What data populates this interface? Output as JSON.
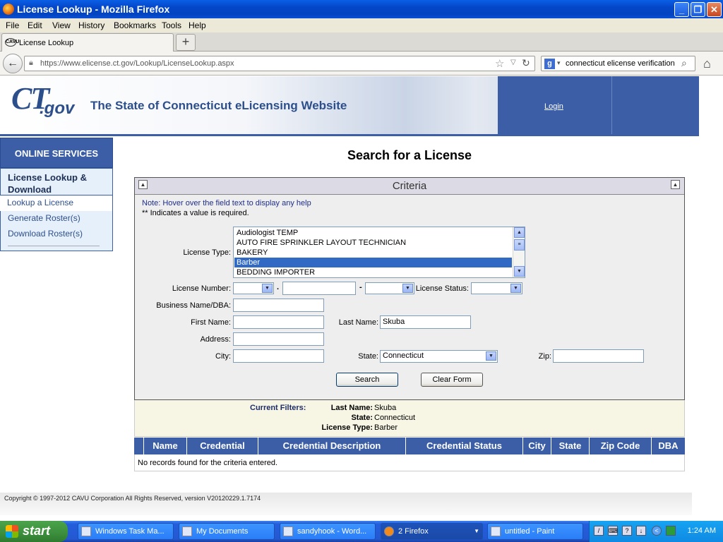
{
  "window": {
    "title": "License Lookup - Mozilla Firefox",
    "minimize": "_",
    "maximize": "❐",
    "close": "✕"
  },
  "menu": [
    "File",
    "Edit",
    "View",
    "History",
    "Bookmarks",
    "Tools",
    "Help"
  ],
  "tab": {
    "label": "License Lookup",
    "icon_text": "CAVU",
    "new_tab": "+"
  },
  "nav": {
    "url": "https://www.elicense.ct.gov/Lookup/LicenseLookup.aspx",
    "search_value": "connecticut elicense verification",
    "search_engine_icon": "g"
  },
  "banner": {
    "logo_ct": "CT",
    "logo_gov": ".gov",
    "title": "The State of Connecticut eLicensing Website",
    "login": "Login"
  },
  "sidebar": {
    "header": "ONLINE SERVICES",
    "section": "License Lookup & Download",
    "items": [
      "Lookup a License",
      "Generate Roster(s)",
      "Download Roster(s)"
    ]
  },
  "main": {
    "heading": "Search for a License",
    "criteria_title": "Criteria",
    "note": "Note:  Hover over the field text to display any help",
    "required": "** Indicates a value is required."
  },
  "form": {
    "license_type_label": "License Type:",
    "license_types": [
      "Audiologist TEMP",
      "AUTO FIRE SPRINKLER LAYOUT TECHNICIAN",
      "BAKERY",
      "Barber",
      "BEDDING IMPORTER"
    ],
    "selected_index": 3,
    "license_number_label": "License Number:",
    "dot": ".",
    "dash": "-",
    "license_status_label": "License Status:",
    "business_name_label": "Business Name/DBA:",
    "business_name": "",
    "first_name_label": "First Name:",
    "first_name": "",
    "last_name_label": "Last Name:",
    "last_name": "Skuba",
    "address_label": "Address:",
    "address": "",
    "city_label": "City:",
    "city": "",
    "state_label": "State:",
    "state": "Connecticut",
    "zip_label": "Zip:",
    "zip": "",
    "search_button": "Search",
    "clear_button": "Clear Form"
  },
  "filters": {
    "header": "Current Filters:",
    "last_name_label": "Last Name:",
    "last_name": "Skuba",
    "state_label": "State:",
    "state": "Connecticut",
    "license_type_label": "License Type:",
    "license_type": "Barber"
  },
  "results": {
    "columns": [
      "Name",
      "Credential",
      "Credential Description",
      "Credential Status",
      "City",
      "State",
      "Zip Code",
      "DBA"
    ],
    "empty_message": "No records found for the criteria entered."
  },
  "footer": {
    "copyright": "Copyright © 1997-2012 CAVU Corporation All Rights Reserved, version V20120229.1.7174"
  },
  "taskbar": {
    "start": "start",
    "tasks": [
      "Windows Task Ma...",
      "My Documents",
      "sandyhook - Word...",
      "2 Firefox",
      "untitled - Paint"
    ],
    "clock": "1:24 AM"
  }
}
